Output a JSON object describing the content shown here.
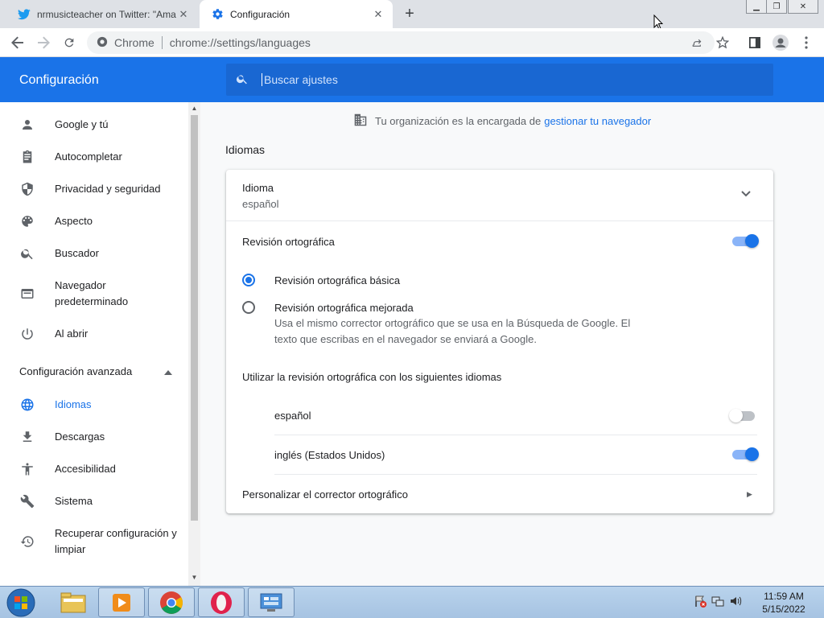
{
  "browser": {
    "tabs": [
      {
        "title": "nrmusicteacher on Twitter: \"Ama",
        "favicon": "twitter-icon",
        "active": false
      },
      {
        "title": "Configuración",
        "favicon": "settings-gear-icon",
        "active": true
      }
    ],
    "omnibox": {
      "site_label": "Chrome",
      "url": "chrome://settings/languages"
    }
  },
  "settings": {
    "header_title": "Configuración",
    "search_placeholder": "Buscar ajustes"
  },
  "sidebar": {
    "items": [
      {
        "label": "Google y tú",
        "icon": "person-icon"
      },
      {
        "label": "Autocompletar",
        "icon": "clipboard-icon"
      },
      {
        "label": "Privacidad y seguridad",
        "icon": "shield-icon"
      },
      {
        "label": "Aspecto",
        "icon": "palette-icon"
      },
      {
        "label": "Buscador",
        "icon": "search-icon"
      },
      {
        "label": "Navegador predeterminado",
        "icon": "browser-window-icon"
      },
      {
        "label": "Al abrir",
        "icon": "power-icon"
      }
    ],
    "advanced_label": "Configuración avanzada",
    "advanced_items": [
      {
        "label": "Idiomas",
        "icon": "globe-icon",
        "selected": true
      },
      {
        "label": "Descargas",
        "icon": "download-icon"
      },
      {
        "label": "Accesibilidad",
        "icon": "accessibility-icon"
      },
      {
        "label": "Sistema",
        "icon": "wrench-icon"
      },
      {
        "label": "Recuperar configuración y limpiar",
        "icon": "history-icon"
      }
    ]
  },
  "main": {
    "managed_text": "Tu organización es la encargada de",
    "managed_link": "gestionar tu navegador",
    "section_title": "Idiomas",
    "language_row": {
      "title": "Idioma",
      "value": "español"
    },
    "spellcheck": {
      "label": "Revisión ortográfica",
      "enabled": true,
      "options": [
        {
          "label": "Revisión ortográfica básica",
          "checked": true
        },
        {
          "label": "Revisión ortográfica mejorada",
          "checked": false,
          "description": "Usa el mismo corrector ortográfico que se usa en la Búsqueda de Google. El texto que escribas en el navegador se enviará a Google."
        }
      ],
      "languages_header": "Utilizar la revisión ortográfica con los siguientes idiomas",
      "languages": [
        {
          "label": "español",
          "enabled": false
        },
        {
          "label": "inglés (Estados Unidos)",
          "enabled": true
        }
      ],
      "customize_label": "Personalizar el corrector ortográfico"
    }
  },
  "taskbar": {
    "time": "11:59 AM",
    "date": "5/15/2022"
  },
  "colors": {
    "accent": "#1a73e8",
    "header": "#1a73e8",
    "search_bg": "#1967d2"
  }
}
